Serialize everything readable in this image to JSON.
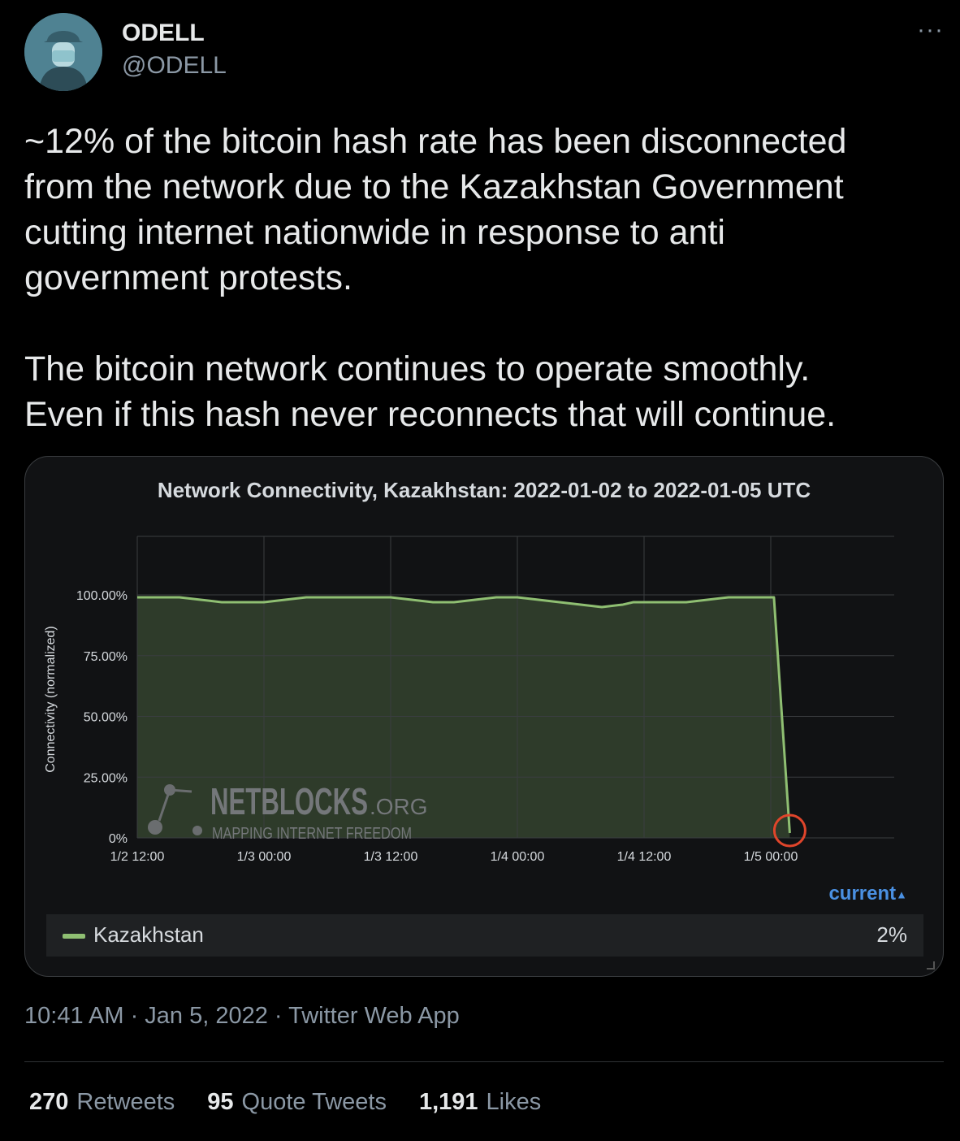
{
  "author": {
    "name": "ODELL",
    "handle": "@ODELL"
  },
  "more_label": "···",
  "tweet": {
    "lines_p1": [
      "~12% of the bitcoin hash rate has been disconnected",
      "from the network due to the Kazakhstan Government",
      "cutting internet nationwide in response to anti",
      "government protests."
    ],
    "lines_p2": [
      "The bitcoin network continues to operate smoothly.",
      "Even if this hash never reconnects that will continue."
    ]
  },
  "chart_data": {
    "type": "area",
    "title": "Network Connectivity, Kazakhstan: 2022-01-02 to 2022-01-05 UTC",
    "ylabel": "Connectivity (normalized)",
    "xlabel": "",
    "ylim": [
      0,
      100
    ],
    "yticks": [
      "0%",
      "25.00%",
      "50.00%",
      "75.00%",
      "100.00%"
    ],
    "xticks": [
      "1/2 12:00",
      "1/3 00:00",
      "1/3 12:00",
      "1/4 00:00",
      "1/4 12:00",
      "1/5 00:00"
    ],
    "grid": true,
    "series": [
      {
        "name": "Kazakhstan",
        "color": "#8fbf72",
        "x_hours": [
          0,
          2,
          4,
          6,
          8,
          10,
          12,
          14,
          16,
          18,
          20,
          22,
          24,
          26,
          28,
          30,
          32,
          34,
          36,
          38,
          40,
          42,
          44,
          46,
          47,
          48,
          50,
          52,
          54,
          56,
          58,
          59,
          60.3,
          61.8
        ],
        "values": [
          99,
          99,
          99,
          98,
          97,
          97,
          97,
          98,
          99,
          99,
          99,
          99,
          99,
          98,
          97,
          97,
          98,
          99,
          99,
          98,
          97,
          96,
          95,
          96,
          97,
          97,
          97,
          97,
          98,
          99,
          99,
          99,
          99,
          2
        ]
      }
    ],
    "current_label": "current",
    "current_value": "2%",
    "watermark": {
      "brand": "NETBLOCKS",
      "suffix": ".ORG",
      "tagline": "MAPPING INTERNET FREEDOM"
    }
  },
  "footer": {
    "timestamp": "10:41 AM · Jan 5, 2022 · Twitter Web App",
    "retweets_count": "270",
    "retweets_label": "Retweets",
    "quotes_count": "95",
    "quotes_label": "Quote Tweets",
    "likes_count": "1,191",
    "likes_label": "Likes"
  },
  "colors": {
    "accent": "#4a90e2",
    "series": "#8fbf72",
    "marker": "#e0452b"
  }
}
